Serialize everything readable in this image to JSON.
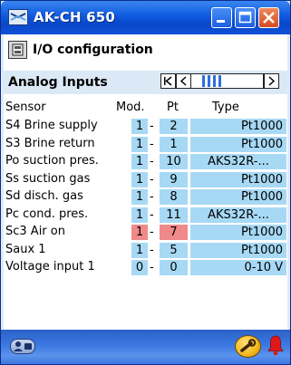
{
  "window": {
    "title": "AK-CH 650"
  },
  "page": {
    "title": "I/O configuration",
    "section_title": "Analog Inputs"
  },
  "table": {
    "headers": {
      "sensor": "Sensor",
      "mod": "Mod.",
      "pt": "Pt",
      "type": "Type"
    },
    "rows": [
      {
        "sensor": "S4 Brine supply",
        "mod": "1",
        "dash": "-",
        "pt": "2",
        "type": "Pt1000"
      },
      {
        "sensor": "S3 Brine return",
        "mod": "1",
        "dash": "-",
        "pt": "1",
        "type": "Pt1000"
      },
      {
        "sensor": "Po suction pres.",
        "mod": "1",
        "dash": "-",
        "pt": "10",
        "type": "AKS32R-..."
      },
      {
        "sensor": "Ss suction gas",
        "mod": "1",
        "dash": "-",
        "pt": "9",
        "type": "Pt1000"
      },
      {
        "sensor": "Sd disch. gas",
        "mod": "1",
        "dash": "-",
        "pt": "8",
        "type": "Pt1000"
      },
      {
        "sensor": "Pc cond. pres.",
        "mod": "1",
        "dash": "-",
        "pt": "11",
        "type": "AKS32R-..."
      },
      {
        "sensor": "Sc3 Air on",
        "mod": "1",
        "dash": "-",
        "pt": "7",
        "type": "Pt1000",
        "alarm": true
      },
      {
        "sensor": "Saux 1",
        "mod": "1",
        "dash": "-",
        "pt": "5",
        "type": "Pt1000"
      },
      {
        "sensor": "Voltage input 1",
        "mod": "0",
        "dash": "-",
        "pt": "0",
        "type": "0-10 V"
      }
    ]
  },
  "icons": {
    "app": "ak-ch-app-icon",
    "config": "io-config-icon",
    "user": "user-icon",
    "service": "service-wrench-icon",
    "alarm": "alarm-bell-icon"
  },
  "colors": {
    "cell": "#a7d9f5",
    "alarm_cell": "#f08a8a",
    "title_bar": "#0e59e0",
    "bottom_bar": "#3b78e0"
  }
}
